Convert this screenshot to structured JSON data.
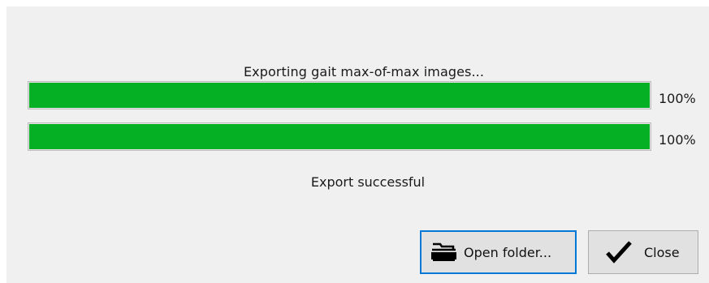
{
  "dialog": {
    "message": "Exporting gait max-of-max images...",
    "status": "Export successful"
  },
  "progress_bars": [
    {
      "value": 1.0,
      "label": "100%"
    },
    {
      "value": 1.0,
      "label": "100%"
    }
  ],
  "buttons": {
    "open_folder": {
      "label": "Open folder...",
      "icon": "folder-tray-icon"
    },
    "close": {
      "label": "Close",
      "icon": "checkmark-icon"
    }
  },
  "colors": {
    "progress_fill": "#06b025",
    "dialog_bg": "#f0f0f0",
    "focus_border": "#0078d7"
  }
}
